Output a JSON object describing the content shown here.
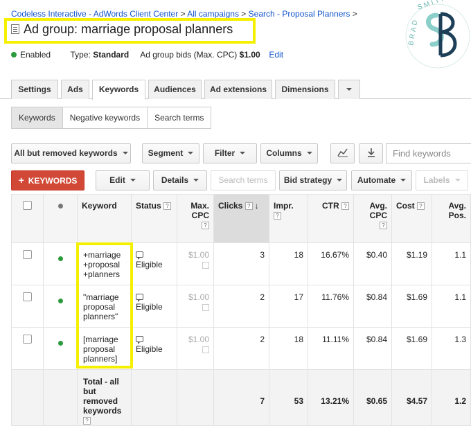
{
  "breadcrumb": {
    "account": "Codeless Interactive - AdWords Client Center",
    "sep": ">",
    "campaigns": "All campaigns",
    "campaign": "Search - Proposal Planners"
  },
  "header": {
    "title_prefix": "Ad group:",
    "title_name": "marriage proposal planners",
    "status": "Enabled",
    "type_label": "Type:",
    "type_value": "Standard",
    "bids_label": "Ad group bids (Max. CPC)",
    "bids_value": "$1.00",
    "edit": "Edit"
  },
  "logo": {
    "text_top": "BRAD",
    "text_right": "SMITH",
    "monogram": "BS"
  },
  "tabs": [
    "Settings",
    "Ads",
    "Keywords",
    "Audiences",
    "Ad extensions",
    "Dimensions"
  ],
  "subtabs": [
    "Keywords",
    "Negative keywords",
    "Search terms"
  ],
  "toolbar": {
    "filter_view": "All but removed keywords",
    "segment": "Segment",
    "filter": "Filter",
    "columns": "Columns",
    "search_placeholder": "Find keywords",
    "add_keywords": "KEYWORDS",
    "edit": "Edit",
    "details": "Details",
    "search_terms": "Search terms",
    "bid_strategy": "Bid strategy",
    "automate": "Automate",
    "labels": "Labels"
  },
  "table": {
    "headers": {
      "keyword": "Keyword",
      "status": "Status",
      "max_cpc": "Max. CPC",
      "clicks": "Clicks",
      "impr": "Impr.",
      "ctr": "CTR",
      "avg_cpc": "Avg. CPC",
      "cost": "Cost",
      "avg_pos": "Avg. Pos."
    },
    "rows": [
      {
        "kw1": "+marriage",
        "kw2": "+proposal",
        "kw3": "+planners",
        "status": "Eligible",
        "max_cpc": "$1.00",
        "clicks": "3",
        "impr": "18",
        "ctr": "16.67%",
        "avg_cpc": "$0.40",
        "cost": "$1.19",
        "avg_pos": "1.1"
      },
      {
        "kw1": "\"marriage",
        "kw2": "proposal",
        "kw3": "planners\"",
        "status": "Eligible",
        "max_cpc": "$1.00",
        "clicks": "2",
        "impr": "17",
        "ctr": "11.76%",
        "avg_cpc": "$0.84",
        "cost": "$1.69",
        "avg_pos": "1.1"
      },
      {
        "kw1": "[marriage",
        "kw2": "proposal",
        "kw3": "planners]",
        "status": "Eligible",
        "max_cpc": "$1.00",
        "clicks": "2",
        "impr": "18",
        "ctr": "11.11%",
        "avg_cpc": "$0.84",
        "cost": "$1.69",
        "avg_pos": "1.3"
      }
    ],
    "total": {
      "l1": "Total - all",
      "l2": "but",
      "l3": "removed",
      "l4": "keywords",
      "clicks": "7",
      "impr": "53",
      "ctr": "13.21%",
      "avg_cpc": "$0.65",
      "cost": "$4.57",
      "avg_pos": "1.2"
    }
  }
}
